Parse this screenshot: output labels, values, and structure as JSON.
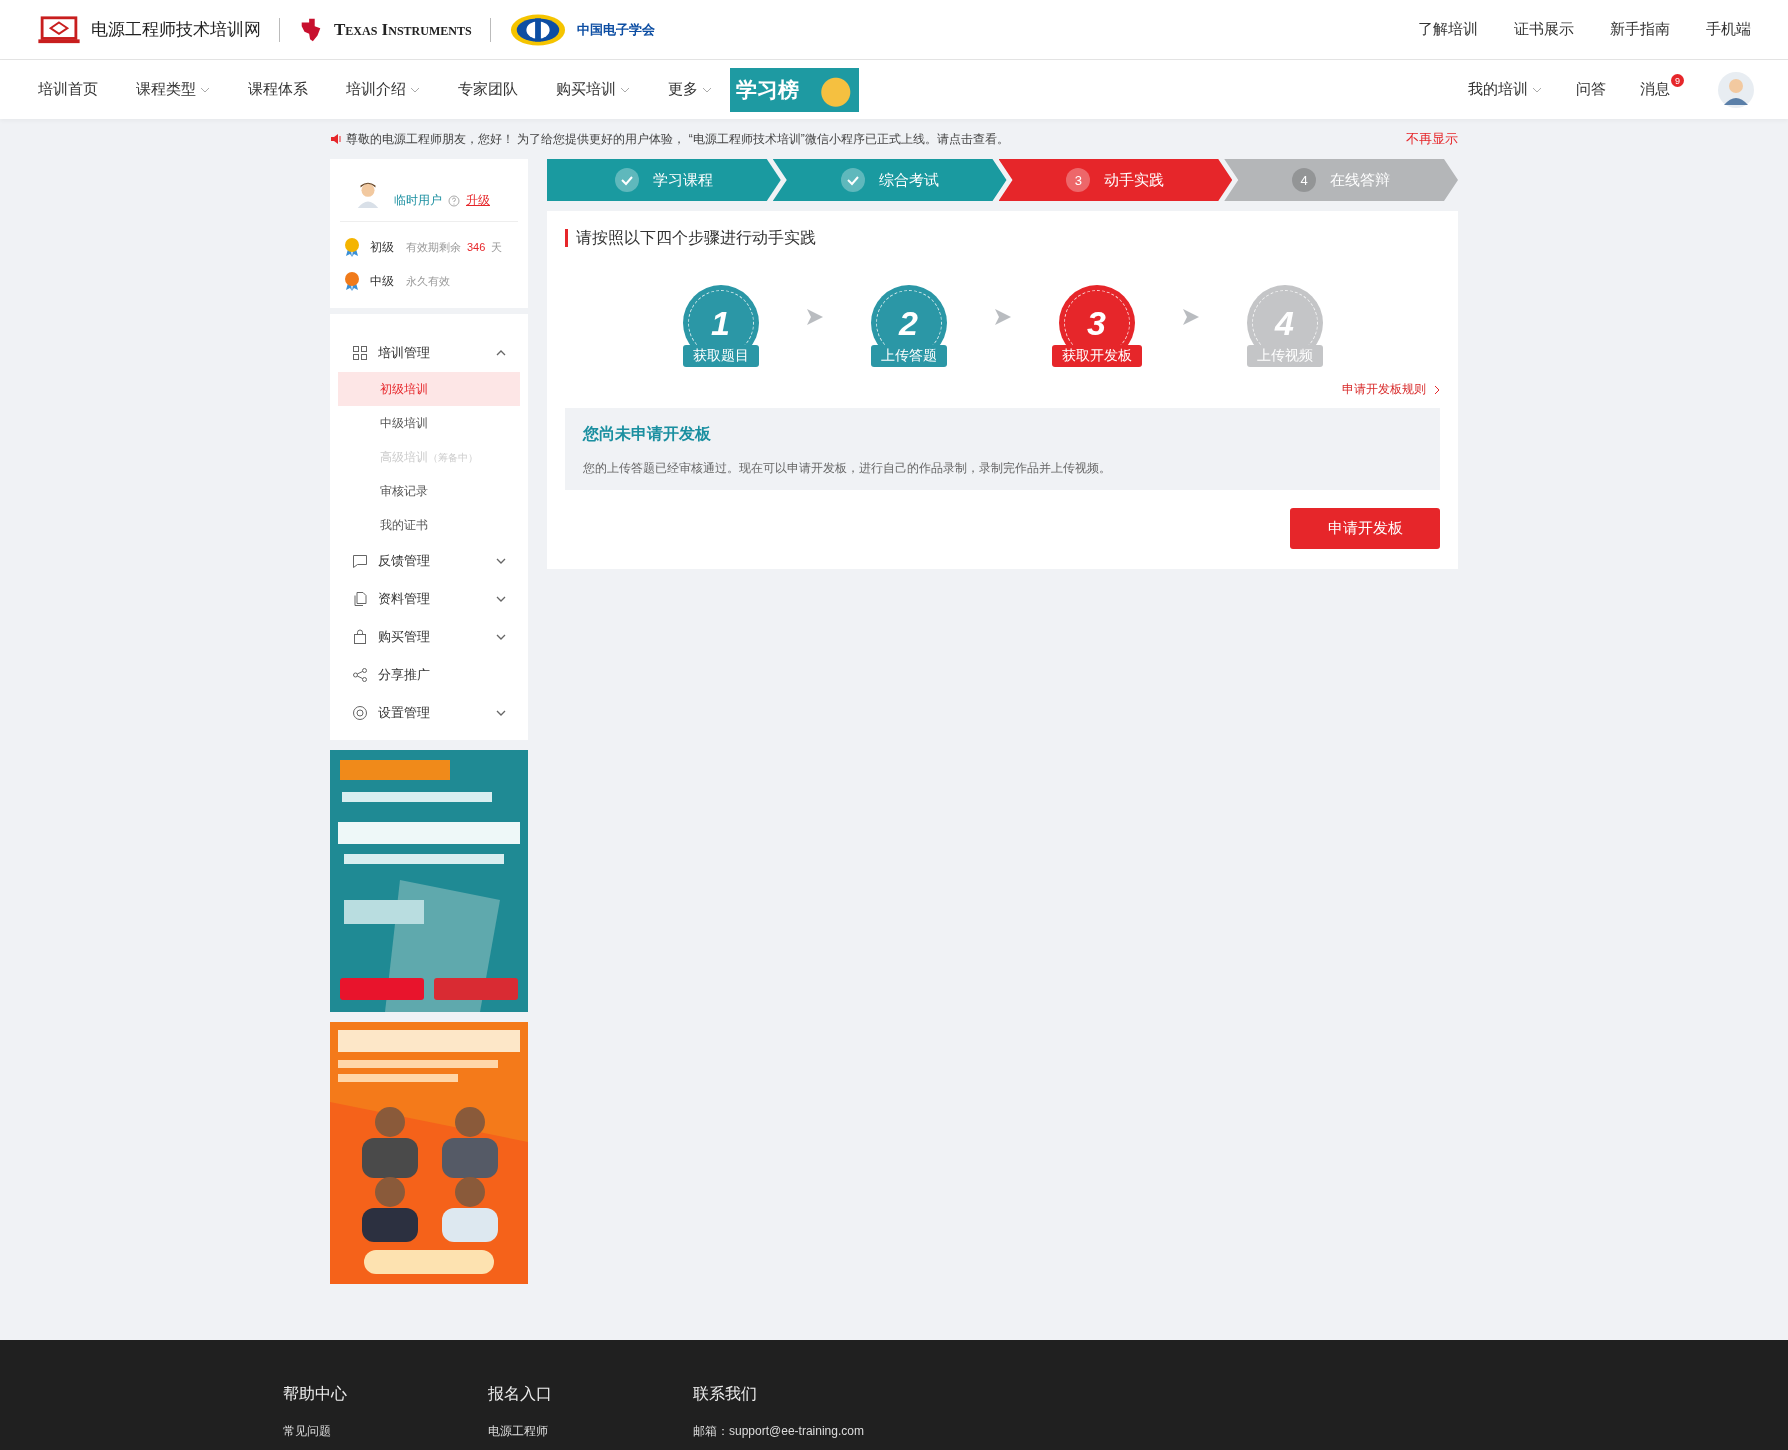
{
  "header": {
    "site_name": "电源工程师技术培训网",
    "partner": "Texas Instruments",
    "society": "中国电子学会",
    "top_links": [
      "了解培训",
      "证书展示",
      "新手指南",
      "手机端"
    ]
  },
  "nav": {
    "items": [
      {
        "label": "培训首页",
        "dropdown": false
      },
      {
        "label": "课程类型",
        "dropdown": true
      },
      {
        "label": "课程体系",
        "dropdown": false
      },
      {
        "label": "培训介绍",
        "dropdown": true
      },
      {
        "label": "专家团队",
        "dropdown": false
      },
      {
        "label": "购买培训",
        "dropdown": true
      },
      {
        "label": "更多",
        "dropdown": true
      }
    ],
    "rank_banner": "学习榜",
    "right": [
      {
        "label": "我的培训",
        "dropdown": true
      },
      {
        "label": "问答",
        "dropdown": false
      },
      {
        "label": "消息",
        "dropdown": false,
        "badge": "9"
      }
    ]
  },
  "notice": {
    "text": "尊敬的电源工程师朋友，您好！ 为了给您提供更好的用户体验， “电源工程师技术培训”微信小程序已正式上线。请点击查看。",
    "dismiss": "不再显示"
  },
  "sidebar": {
    "user": {
      "name": "临时用户",
      "upgrade": "升级"
    },
    "levels": [
      {
        "name": "初级",
        "validity": "有效期剩余",
        "days": "346",
        "unit": "天",
        "color": "#f4b400"
      },
      {
        "name": "中级",
        "validity": "永久有效",
        "color": "#f07a1a"
      }
    ],
    "menu": [
      {
        "label": "培训管理",
        "expandable": true,
        "expanded": true,
        "children": [
          {
            "label": "初级培训",
            "selected": true,
            "disabled": false
          },
          {
            "label": "中级培训",
            "selected": false,
            "disabled": false
          },
          {
            "label": "高级培训",
            "note": "（筹备中）",
            "selected": false,
            "disabled": true
          },
          {
            "label": "审核记录",
            "selected": false,
            "disabled": false
          },
          {
            "label": "我的证书",
            "selected": false,
            "disabled": false
          }
        ]
      },
      {
        "label": "反馈管理",
        "expandable": true,
        "expanded": false
      },
      {
        "label": "资料管理",
        "expandable": true,
        "expanded": false
      },
      {
        "label": "购买管理",
        "expandable": true,
        "expanded": false
      },
      {
        "label": "分享推广",
        "expandable": false
      },
      {
        "label": "设置管理",
        "expandable": true,
        "expanded": false
      }
    ]
  },
  "progress": [
    {
      "label": "学习课程",
      "completed": true,
      "selected": false
    },
    {
      "label": "综合考试",
      "completed": true,
      "selected": false
    },
    {
      "label": "动手实践",
      "number": "3",
      "completed": false,
      "selected": true
    },
    {
      "label": "在线答辩",
      "number": "4",
      "completed": false,
      "selected": false
    }
  ],
  "card": {
    "heading": "请按照以下四个步骤进行动手实践",
    "steps": [
      {
        "number": "1",
        "label": "获取题目",
        "completed": true,
        "selected": false
      },
      {
        "number": "2",
        "label": "上传答题",
        "completed": true,
        "selected": false
      },
      {
        "number": "3",
        "label": "获取开发板",
        "completed": false,
        "selected": true
      },
      {
        "number": "4",
        "label": "上传视频",
        "completed": false,
        "selected": false
      }
    ],
    "rules_link": "申请开发板规则",
    "info": {
      "title": "您尚未申请开发板",
      "text": "您的上传答题已经审核通过。现在可以申请开发板，进行自己的作品录制，录制完作品并上传视频。"
    },
    "button": "申请开发板"
  },
  "footer": {
    "columns": [
      {
        "title": "帮助中心",
        "first_item": "常见问题"
      },
      {
        "title": "报名入口",
        "first_item": "电源工程师"
      },
      {
        "title": "联系我们",
        "first_item": "邮箱：support@ee-training.com"
      }
    ]
  }
}
